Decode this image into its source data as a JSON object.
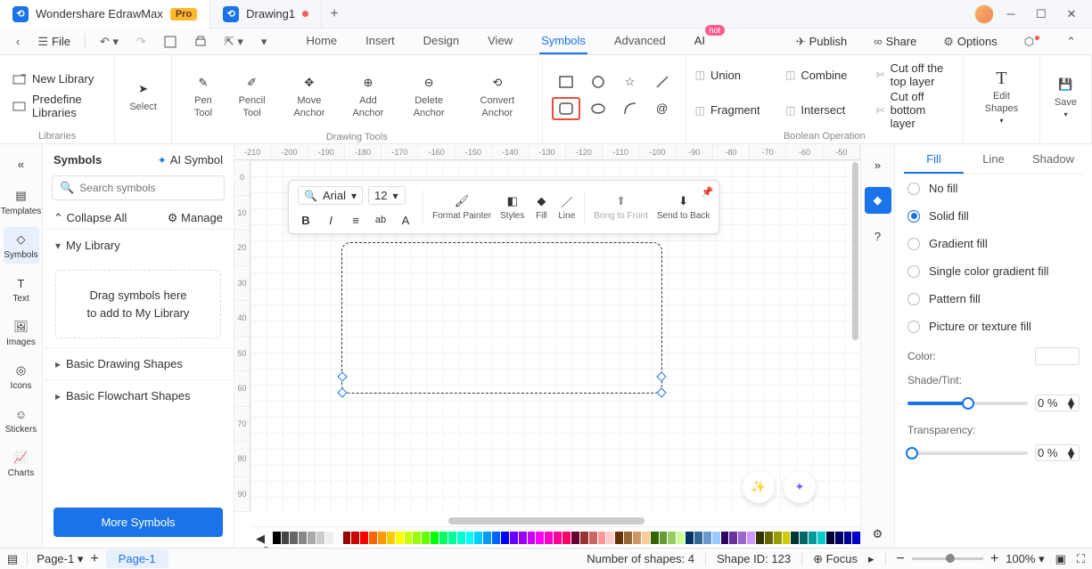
{
  "app": {
    "name": "Wondershare EdrawMax",
    "pro": "Pro"
  },
  "tabs": [
    {
      "name": "Drawing1"
    }
  ],
  "toolbar": {
    "file": "File",
    "publish": "Publish",
    "share": "Share",
    "options": "Options"
  },
  "menu": [
    "Home",
    "Insert",
    "Design",
    "View",
    "Symbols",
    "Advanced",
    "AI"
  ],
  "menu_active": 4,
  "ribbon": {
    "libraries": {
      "title": "Libraries",
      "new": "New Library",
      "predef": "Predefine Libraries"
    },
    "select": "Select",
    "drawing_title": "Drawing Tools",
    "tools": [
      "Pen Tool",
      "Pencil Tool",
      "Move Anchor",
      "Add Anchor",
      "Delete Anchor",
      "Convert Anchor"
    ],
    "bool_title": "Boolean Operation",
    "bool": [
      "Union",
      "Combine",
      "Cut off the top layer",
      "Fragment",
      "Intersect",
      "Cut off bottom layer"
    ],
    "edit": "Edit Shapes",
    "save": "Save"
  },
  "leftnav": [
    "Templates",
    "Symbols",
    "Text",
    "Images",
    "Icons",
    "Stickers",
    "Charts"
  ],
  "leftnav_active": 1,
  "symbols": {
    "title": "Symbols",
    "ai": "AI Symbol",
    "search_ph": "Search symbols",
    "collapse": "Collapse All",
    "manage": "Manage",
    "mylib": "My Library",
    "drop1": "Drag symbols here",
    "drop2": "to add to My Library",
    "sec1": "Basic Drawing Shapes",
    "sec2": "Basic Flowchart Shapes",
    "more": "More Symbols"
  },
  "ruler_h": [
    "-210",
    "-200",
    "-190",
    "-180",
    "-170",
    "-160",
    "-150",
    "-140",
    "-130",
    "-120",
    "-110",
    "-100",
    "-90",
    "-80",
    "-70",
    "-60",
    "-50"
  ],
  "ruler_v": [
    "0",
    "10",
    "20",
    "30",
    "40",
    "50",
    "60",
    "70",
    "80",
    "90"
  ],
  "float": {
    "font": "Arial",
    "size": "12",
    "painter": "Format Painter",
    "styles": "Styles",
    "fill": "Fill",
    "line": "Line",
    "front": "Bring to Front",
    "back": "Send to Back"
  },
  "palette": [
    "#000",
    "#444",
    "#666",
    "#888",
    "#aaa",
    "#ccc",
    "#eee",
    "#fff",
    "#900",
    "#c00",
    "#f00",
    "#f60",
    "#f90",
    "#fc0",
    "#ff0",
    "#cf0",
    "#9f0",
    "#6f0",
    "#0f0",
    "#0f6",
    "#0f9",
    "#0fc",
    "#0ff",
    "#0cf",
    "#09f",
    "#06f",
    "#00f",
    "#60f",
    "#90f",
    "#c0f",
    "#f0f",
    "#f0c",
    "#f09",
    "#f06",
    "#603",
    "#933",
    "#c66",
    "#f99",
    "#fcc",
    "#630",
    "#963",
    "#c96",
    "#fc9",
    "#360",
    "#693",
    "#9c6",
    "#cf9",
    "#036",
    "#369",
    "#69c",
    "#9cf",
    "#306",
    "#639",
    "#96c",
    "#c9f",
    "#330",
    "#660",
    "#990",
    "#cc0",
    "#033",
    "#066",
    "#099",
    "#0cc",
    "#003",
    "#006",
    "#009",
    "#00c"
  ],
  "props": {
    "tabs": [
      "Fill",
      "Line",
      "Shadow"
    ],
    "tabs_active": 0,
    "opts": [
      "No fill",
      "Solid fill",
      "Gradient fill",
      "Single color gradient fill",
      "Pattern fill",
      "Picture or texture fill"
    ],
    "opts_active": 1,
    "color": "Color:",
    "shade": "Shade/Tint:",
    "trans": "Transparency:",
    "shade_val": "0 %",
    "trans_val": "0 %"
  },
  "status": {
    "page_sel": "Page-1",
    "add": "+",
    "page_tab": "Page-1",
    "shapes": "Number of shapes: 4",
    "shapeid": "Shape ID: 123",
    "focus": "Focus",
    "zoom": "100%"
  }
}
